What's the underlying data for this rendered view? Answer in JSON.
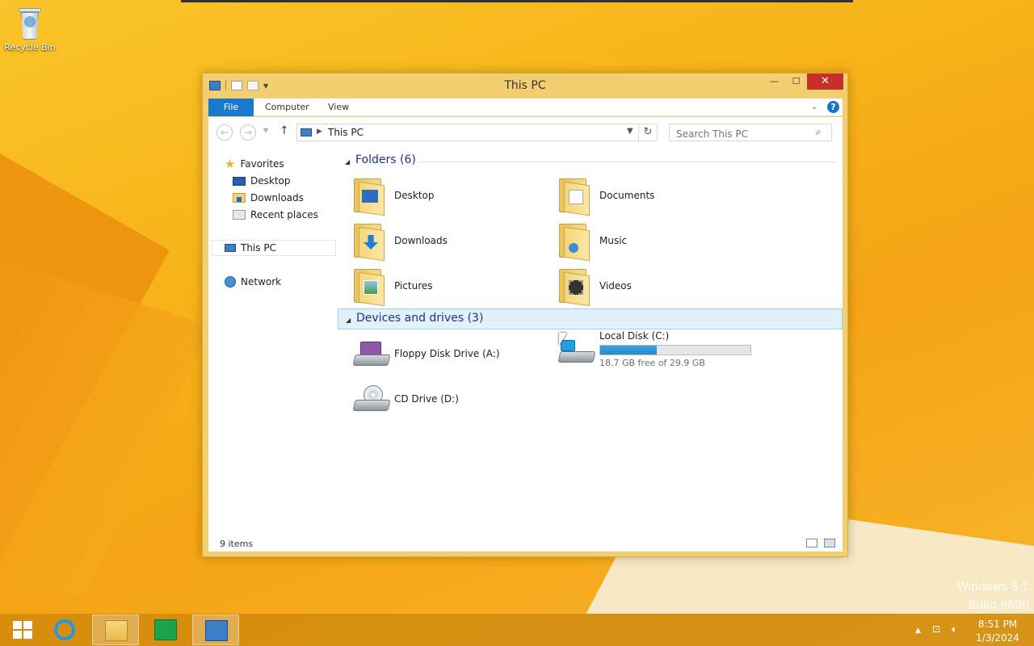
{
  "desktop": {
    "recycle_bin_label": "Recycle Bin",
    "watermark_line1": "Windows 8.1",
    "watermark_line2": "Build 9600"
  },
  "window": {
    "title": "This PC",
    "ribbon": {
      "tabs": [
        "File",
        "Computer",
        "View"
      ]
    },
    "address": {
      "path": "This PC"
    },
    "search": {
      "placeholder": "Search This PC"
    },
    "sidebar": {
      "favorites": "Favorites",
      "favorites_items": [
        "Desktop",
        "Downloads",
        "Recent places"
      ],
      "this_pc": "This PC",
      "network": "Network"
    },
    "groups": {
      "folders_title": "Folders (6)",
      "devices_title": "Devices and drives (3)"
    },
    "folders": [
      "Desktop",
      "Documents",
      "Downloads",
      "Music",
      "Pictures",
      "Videos"
    ],
    "drives": {
      "floppy": "Floppy Disk Drive (A:)",
      "local": "Local Disk (C:)",
      "local_free": "18.7 GB free of 29.9 GB",
      "local_used_fraction": 0.375,
      "cd": "CD Drive (D:)"
    },
    "status": {
      "items": "9 items"
    }
  },
  "taskbar": {
    "time": "8:51 PM",
    "date": "1/3/2024"
  },
  "colors": {
    "accent": "#1979ca",
    "close": "#c7302a",
    "frame": "#f3cf72",
    "storage_fill": "#2689cf"
  }
}
